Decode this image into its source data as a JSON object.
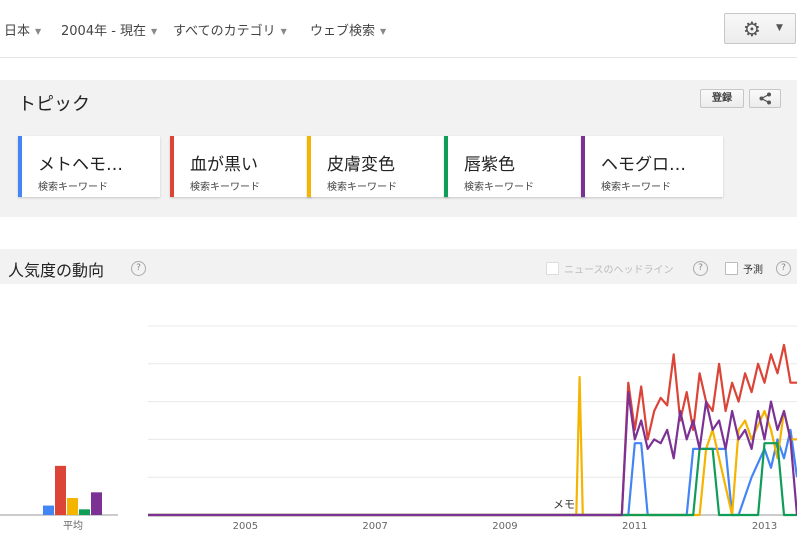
{
  "filters": [
    {
      "label": "日本"
    },
    {
      "label": "2004年 - 現在"
    },
    {
      "label": "すべてのカテゴリ"
    },
    {
      "label": "ウェブ検索"
    }
  ],
  "settings": {
    "icon": "gear-icon",
    "caret": "▼"
  },
  "topics": {
    "title": "トピック",
    "register_label": "登録",
    "share_icon": "share-icon",
    "cards": [
      {
        "label": "メトヘモ…",
        "sub": "検索キーワード",
        "color": "#4285f4"
      },
      {
        "label": "血が黒い",
        "sub": "検索キーワード",
        "color": "#db4437"
      },
      {
        "label": "皮膚変色",
        "sub": "検索キーワード",
        "color": "#f4b400"
      },
      {
        "label": "唇紫色",
        "sub": "検索キーワード",
        "color": "#0f9d58"
      },
      {
        "label": "ヘモグロ…",
        "sub": "検索キーワード",
        "color": "#7b3294"
      }
    ]
  },
  "trend": {
    "title": "人気度の動向",
    "help": "?",
    "news_label": "ニュースのヘッドライン",
    "forecast_label": "予測",
    "avg_label": "平均",
    "memo_label": "メモ"
  },
  "chart_data": {
    "type": "line",
    "x_tick_labels": [
      "2005",
      "2007",
      "2009",
      "2011",
      "2013"
    ],
    "x_range": [
      2004.0,
      2014.0
    ],
    "y_range": [
      0,
      100
    ],
    "grid": true,
    "averages": [
      {
        "name": "メトヘモ…",
        "value": 5
      },
      {
        "name": "血が黒い",
        "value": 26
      },
      {
        "name": "皮膚変色",
        "value": 9
      },
      {
        "name": "唇紫色",
        "value": 3
      },
      {
        "name": "ヘモグロ…",
        "value": 12
      }
    ],
    "series": [
      {
        "name": "メトヘモ…",
        "color": "#4285f4",
        "x": [
          2004.0,
          2011.4,
          2011.5,
          2011.6,
          2011.7,
          2012.3,
          2012.4,
          2012.9,
          2013.0,
          2013.1,
          2013.3,
          2013.5,
          2013.6,
          2013.7,
          2013.8,
          2013.9,
          2014.0
        ],
        "y": [
          0,
          0,
          38,
          38,
          0,
          0,
          35,
          35,
          0,
          0,
          20,
          35,
          25,
          40,
          30,
          45,
          20
        ]
      },
      {
        "name": "血が黒い",
        "color": "#db4437",
        "x": [
          2004.0,
          2011.3,
          2011.4,
          2011.5,
          2011.6,
          2011.7,
          2011.8,
          2011.9,
          2012.0,
          2012.1,
          2012.2,
          2012.3,
          2012.4,
          2012.5,
          2012.6,
          2012.7,
          2012.8,
          2012.9,
          2013.0,
          2013.1,
          2013.2,
          2013.3,
          2013.4,
          2013.5,
          2013.6,
          2013.7,
          2013.8,
          2013.9,
          2014.0
        ],
        "y": [
          0,
          0,
          70,
          45,
          68,
          40,
          55,
          62,
          58,
          85,
          50,
          65,
          45,
          75,
          60,
          55,
          80,
          55,
          70,
          60,
          75,
          65,
          80,
          70,
          85,
          75,
          90,
          70,
          70
        ]
      },
      {
        "name": "皮膚変色",
        "color": "#f4b400",
        "x": [
          2004.0,
          2010.6,
          2010.65,
          2010.7,
          2012.5,
          2012.6,
          2012.7,
          2012.8,
          2013.0,
          2013.1,
          2013.2,
          2013.3,
          2013.5,
          2013.6,
          2013.7,
          2013.8,
          2013.9,
          2014.0
        ],
        "y": [
          0,
          0,
          73,
          0,
          0,
          35,
          45,
          30,
          0,
          45,
          50,
          40,
          55,
          45,
          30,
          55,
          40,
          40
        ]
      },
      {
        "name": "唇紫色",
        "color": "#0f9d58",
        "x": [
          2004.0,
          2012.4,
          2012.5,
          2012.7,
          2012.8,
          2013.4,
          2013.5,
          2013.7,
          2013.8,
          2014.0
        ],
        "y": [
          0,
          0,
          35,
          35,
          0,
          0,
          38,
          38,
          0,
          0
        ]
      },
      {
        "name": "ヘモグロ…",
        "color": "#7b3294",
        "x": [
          2004.0,
          2011.3,
          2011.4,
          2011.5,
          2011.6,
          2011.7,
          2011.8,
          2011.9,
          2012.0,
          2012.1,
          2012.2,
          2012.3,
          2012.4,
          2012.5,
          2012.6,
          2012.7,
          2012.8,
          2012.9,
          2013.0,
          2013.1,
          2013.2,
          2013.3,
          2013.4,
          2013.5,
          2013.6,
          2013.7,
          2013.8,
          2013.9,
          2014.0
        ],
        "y": [
          0,
          0,
          65,
          40,
          50,
          35,
          40,
          38,
          45,
          30,
          55,
          40,
          50,
          35,
          60,
          45,
          50,
          35,
          55,
          40,
          45,
          35,
          55,
          40,
          60,
          45,
          55,
          40,
          0
        ]
      }
    ]
  }
}
